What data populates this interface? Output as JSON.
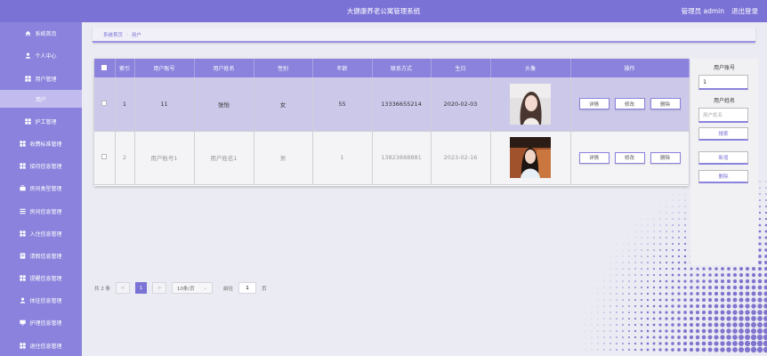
{
  "header": {
    "title": "大健康养老公寓管理系统",
    "user": "管理员 admin",
    "logout": "退出登录"
  },
  "sidebar": {
    "items": [
      {
        "label": "系统首页",
        "icon": "home-icon"
      },
      {
        "label": "个人中心",
        "icon": "user-icon"
      },
      {
        "label": "用户管理",
        "icon": "grid-icon"
      },
      {
        "label": "用户",
        "icon": ""
      },
      {
        "label": "护工管理",
        "icon": "grid-icon"
      },
      {
        "label": "收费标准管理",
        "icon": "grid-icon"
      },
      {
        "label": "接待信息管理",
        "icon": "grid-icon"
      },
      {
        "label": "房间类型管理",
        "icon": "briefcase-icon"
      },
      {
        "label": "房间信息管理",
        "icon": "list-icon"
      },
      {
        "label": "入住信息管理",
        "icon": "grid-icon"
      },
      {
        "label": "请假信息管理",
        "icon": "doc-icon"
      },
      {
        "label": "提醒信息管理",
        "icon": "grid-icon"
      },
      {
        "label": "体征信息管理",
        "icon": "user-icon"
      },
      {
        "label": "护理信息管理",
        "icon": "monitor-icon"
      },
      {
        "label": "退住信息管理",
        "icon": "grid-icon"
      }
    ]
  },
  "breadcrumb": {
    "home": "系统首页",
    "sep": ":",
    "current": "用户"
  },
  "table": {
    "headers": [
      "",
      "索引",
      "用户账号",
      "用户姓名",
      "性别",
      "年龄",
      "联系方式",
      "生日",
      "头像",
      "操作"
    ],
    "rows": [
      {
        "index": "1",
        "account": "11",
        "name": "张怡",
        "gender": "女",
        "age": "55",
        "phone": "13336655214",
        "birthday": "2020-02-03"
      },
      {
        "index": "2",
        "account": "用户账号1",
        "name": "用户姓名1",
        "gender": "男",
        "age": "1",
        "phone": "13823888881",
        "birthday": "2023-02-16"
      }
    ],
    "actions": {
      "detail": "详情",
      "edit": "修改",
      "delete": "删除"
    }
  },
  "pagination": {
    "total": "共 2 条",
    "prev": "<",
    "page": "1",
    "next": ">",
    "size": "10条/页",
    "goto": "前往",
    "goto_value": "1",
    "page_suffix": "页"
  },
  "search_panel": {
    "account_label": "用户账号",
    "account_value": "1",
    "name_label": "用户姓名",
    "name_placeholder": "用户姓名",
    "search_btn": "搜索",
    "add_btn": "新增",
    "delete_btn": "删除"
  }
}
